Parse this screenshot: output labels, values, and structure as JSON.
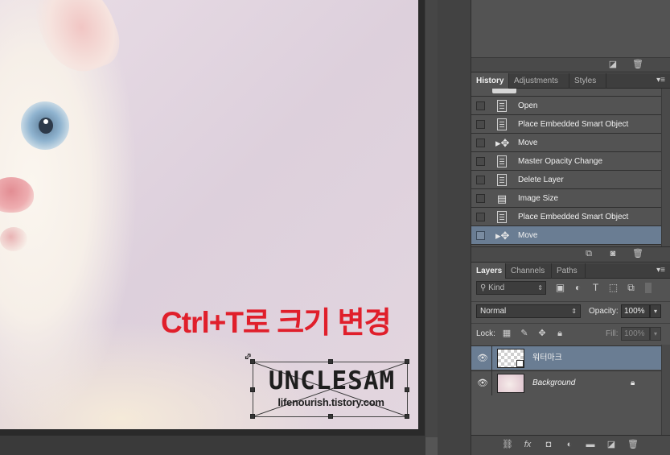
{
  "canvas": {
    "caption": "Ctrl+T로 크기 변경",
    "watermark": {
      "title": "UNCLESAM",
      "subtitle": "lifenourish.tistory.com"
    }
  },
  "top_panel": {
    "footer_icons": [
      "new-icon",
      "trash-icon"
    ]
  },
  "history_panel": {
    "tabs": [
      "History",
      "Adjustments",
      "Styles"
    ],
    "active_tab": "History",
    "items": [
      {
        "label": "Open",
        "icon": "document-icon",
        "selected": false
      },
      {
        "label": "Place Embedded Smart Object",
        "icon": "document-icon",
        "selected": false
      },
      {
        "label": "Move",
        "icon": "move-tool-icon",
        "selected": false
      },
      {
        "label": "Master Opacity Change",
        "icon": "document-icon",
        "selected": false
      },
      {
        "label": "Delete Layer",
        "icon": "document-icon",
        "selected": false
      },
      {
        "label": "Image Size",
        "icon": "image-size-icon",
        "selected": false
      },
      {
        "label": "Place Embedded Smart Object",
        "icon": "document-icon",
        "selected": false
      },
      {
        "label": "Move",
        "icon": "move-tool-icon",
        "selected": true
      }
    ],
    "footer_icons": [
      "new-document-from-state-icon",
      "camera-icon",
      "trash-icon"
    ]
  },
  "layers_panel": {
    "tabs": [
      "Layers",
      "Channels",
      "Paths"
    ],
    "active_tab": "Layers",
    "filter_kind": "Kind",
    "blend_mode": "Normal",
    "opacity_label": "Opacity:",
    "opacity": "100%",
    "lock_label": "Lock:",
    "fill_label": "Fill:",
    "fill": "100%",
    "layers": [
      {
        "name": "워터마크",
        "type": "smart-object",
        "visible": true,
        "selected": true,
        "locked": false
      },
      {
        "name": "Background",
        "type": "background",
        "visible": true,
        "selected": false,
        "locked": true
      }
    ],
    "footer_icons": [
      "link-icon",
      "fx-icon",
      "mask-icon",
      "adjustment-icon",
      "folder-icon",
      "new-layer-icon",
      "trash-icon"
    ]
  },
  "colors": {
    "caption_red": "#e01f2b",
    "selection_blue": "#6a7d93",
    "panel_gray": "#535353"
  }
}
